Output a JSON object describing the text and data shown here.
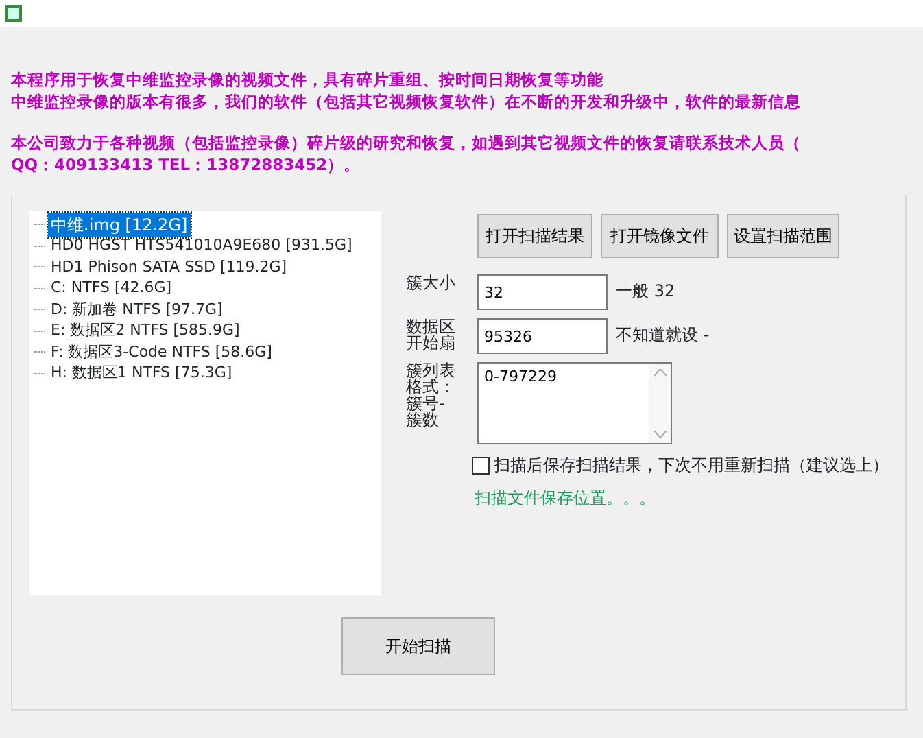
{
  "intro": {
    "lines": [
      "本程序用于恢复中维监控录像的视频文件，具有碎片重组、按时间日期恢复等功能",
      "中维监控录像的版本有很多，我们的软件（包括其它视频恢复软件）在不断的开发和升级中，软件的最新信息"
    ],
    "contact": [
      "本公司致力于各种视频（包括监控录像）碎片级的研究和恢复，如遇到其它视频文件的恢复请联系技术人员（",
      "QQ：409133413 TEL：13872883452）。"
    ]
  },
  "tree": {
    "items": [
      {
        "label": "中维.img  [12.2G]",
        "selected": true
      },
      {
        "label": "HD0  HGST HTS541010A9E680  [931.5G]",
        "selected": false
      },
      {
        "label": "HD1  Phison SATA SSD  [119.2G]",
        "selected": false
      },
      {
        "label": "C:   NTFS  [42.6G]",
        "selected": false
      },
      {
        "label": "D:  新加卷  NTFS  [97.7G]",
        "selected": false
      },
      {
        "label": "E:  数据区2  NTFS  [585.9G]",
        "selected": false
      },
      {
        "label": "F:  数据区3-Code  NTFS  [58.6G]",
        "selected": false
      },
      {
        "label": "H:  数据区1  NTFS  [75.3G]",
        "selected": false
      }
    ]
  },
  "buttons": [
    "打开扫描结果",
    "打开镜像文件",
    "设置扫描范围"
  ],
  "fields": [
    {
      "kind": "input",
      "label": "簇大小",
      "value": "32",
      "hint": "一般 32"
    },
    {
      "kind": "input",
      "label": "数据区开始扇",
      "value": "95326",
      "hint": "不知道就设 -"
    },
    {
      "kind": "textarea",
      "label": "簇列表格式：簇号-簇数",
      "value": "0-797229"
    }
  ],
  "save_option": {
    "label": "扫描后保存扫描结果，下次不用重新扫描（建议选上）",
    "checked": false
  },
  "save_location": "扫描文件保存位置。。。",
  "start_button": "开始扫描"
}
